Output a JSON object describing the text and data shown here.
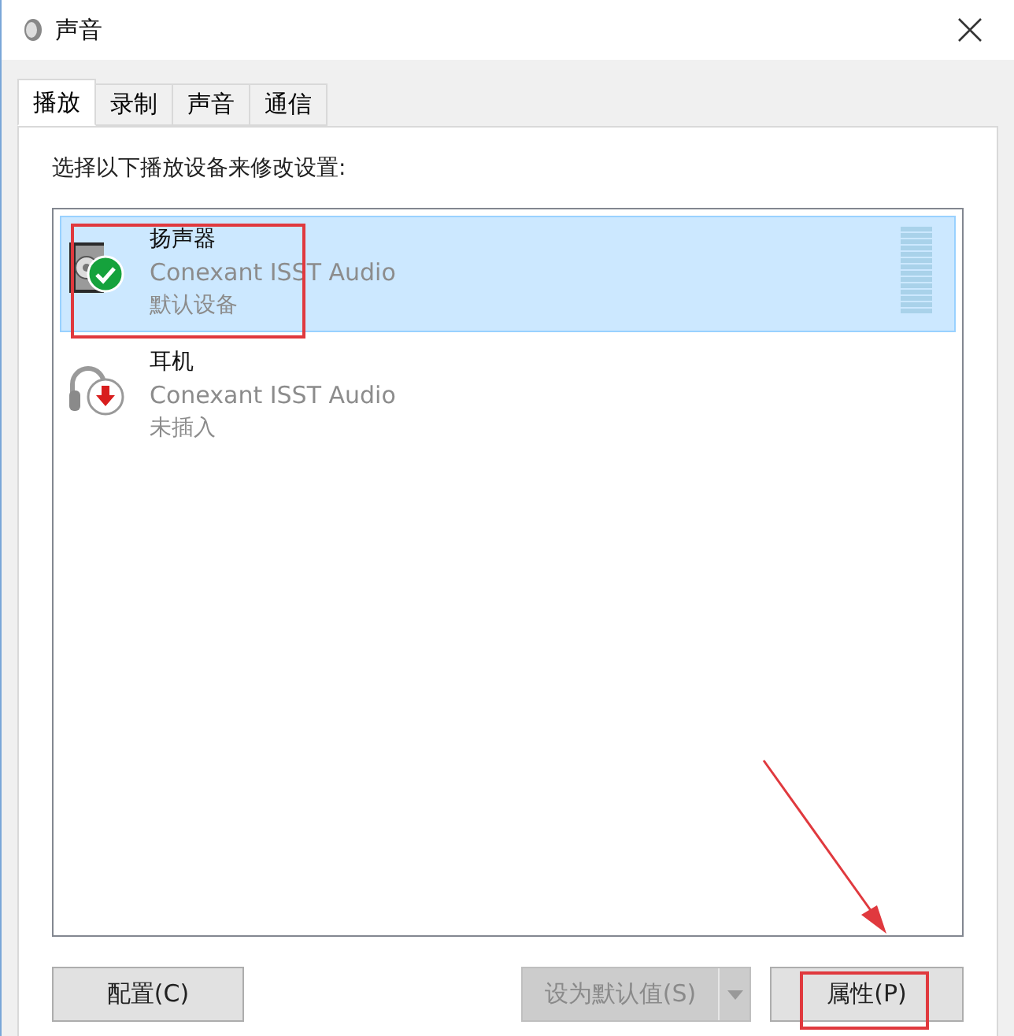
{
  "window": {
    "title": "声音"
  },
  "tabs": [
    {
      "label": "播放",
      "selected": true
    },
    {
      "label": "录制",
      "selected": false
    },
    {
      "label": "声音",
      "selected": false
    },
    {
      "label": "通信",
      "selected": false
    }
  ],
  "instruction": "选择以下播放设备来修改设置:",
  "devices": [
    {
      "name": "扬声器",
      "driver": "Conexant ISST Audio",
      "status": "默认设备",
      "icon": {
        "kind": "speaker",
        "badge": {
          "kind": "check"
        }
      },
      "selected": true
    },
    {
      "name": "耳机",
      "driver": "Conexant ISST Audio",
      "status": "未插入",
      "icon": {
        "kind": "headphones",
        "badge": {
          "kind": "unplugged"
        }
      },
      "selected": false
    }
  ],
  "buttons": {
    "configure": {
      "label": "配置(C)",
      "disabled": false
    },
    "set_default": {
      "label": "设为默认值(S)",
      "disabled": true
    },
    "properties": {
      "label": "属性(P)",
      "disabled": false
    }
  }
}
